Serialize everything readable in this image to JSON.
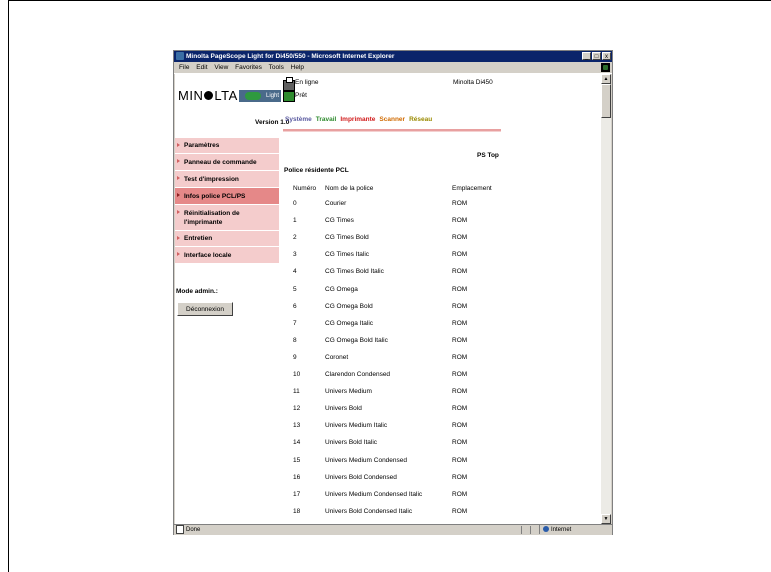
{
  "window": {
    "title": "Minolta PageScope Light for Di450/550 - Microsoft Internet Explorer",
    "controls": [
      "_",
      "□",
      "x"
    ]
  },
  "menu": [
    "File",
    "Edit",
    "View",
    "Favorites",
    "Tools",
    "Help"
  ],
  "brand": {
    "logo_left": "MIN",
    "logo_right": "LTA",
    "product": "Light",
    "version": "Version 1.0"
  },
  "status": {
    "line1": "En ligne",
    "line2": "Prêt",
    "model": "Minolta Di450"
  },
  "tabs": [
    {
      "label": "Système",
      "color": "#5a5aa0"
    },
    {
      "label": "Travail",
      "color": "#2e8b2e"
    },
    {
      "label": "Imprimante",
      "color": "#d11a1a"
    },
    {
      "label": "Scanner",
      "color": "#d06a00"
    },
    {
      "label": "Réseau",
      "color": "#9a8a00"
    }
  ],
  "sidebar": {
    "items": [
      {
        "label": "Paramètres",
        "active": false
      },
      {
        "label": "Panneau de commande",
        "active": false
      },
      {
        "label": "Test d'impression",
        "active": false
      },
      {
        "label": "Infos police PCL/PS",
        "active": true
      },
      {
        "label": "Réinitialisation de l'imprimante",
        "active": false
      },
      {
        "label": "Entretien",
        "active": false
      },
      {
        "label": "Interface locale",
        "active": false
      }
    ],
    "admin_label": "Mode admin.:",
    "logout_label": "Déconnexion"
  },
  "main": {
    "ps_top": "PS Top",
    "section_title": "Police résidente PCL",
    "headers": {
      "num": "Numéro",
      "name": "Nom de la police",
      "loc": "Emplacement"
    },
    "rows": [
      {
        "num": "0",
        "name": "Courier",
        "loc": "ROM"
      },
      {
        "num": "1",
        "name": "CG Times",
        "loc": "ROM"
      },
      {
        "num": "2",
        "name": "CG Times Bold",
        "loc": "ROM"
      },
      {
        "num": "3",
        "name": "CG Times Italic",
        "loc": "ROM"
      },
      {
        "num": "4",
        "name": "CG Times Bold Italic",
        "loc": "ROM"
      },
      {
        "num": "5",
        "name": "CG Omega",
        "loc": "ROM"
      },
      {
        "num": "6",
        "name": "CG Omega Bold",
        "loc": "ROM"
      },
      {
        "num": "7",
        "name": "CG Omega Italic",
        "loc": "ROM"
      },
      {
        "num": "8",
        "name": "CG Omega Bold Italic",
        "loc": "ROM"
      },
      {
        "num": "9",
        "name": "Coronet",
        "loc": "ROM"
      },
      {
        "num": "10",
        "name": "Clarendon Condensed",
        "loc": "ROM"
      },
      {
        "num": "11",
        "name": "Univers Medium",
        "loc": "ROM"
      },
      {
        "num": "12",
        "name": "Univers Bold",
        "loc": "ROM"
      },
      {
        "num": "13",
        "name": "Univers Medium Italic",
        "loc": "ROM"
      },
      {
        "num": "14",
        "name": "Univers Bold Italic",
        "loc": "ROM"
      },
      {
        "num": "15",
        "name": "Univers Medium Condensed",
        "loc": "ROM"
      },
      {
        "num": "16",
        "name": "Univers Bold Condensed",
        "loc": "ROM"
      },
      {
        "num": "17",
        "name": "Univers Medium Condensed Italic",
        "loc": "ROM"
      },
      {
        "num": "18",
        "name": "Univers Bold Condensed Italic",
        "loc": "ROM"
      }
    ]
  },
  "statusbar": {
    "left": "Done",
    "zone": "Internet"
  }
}
